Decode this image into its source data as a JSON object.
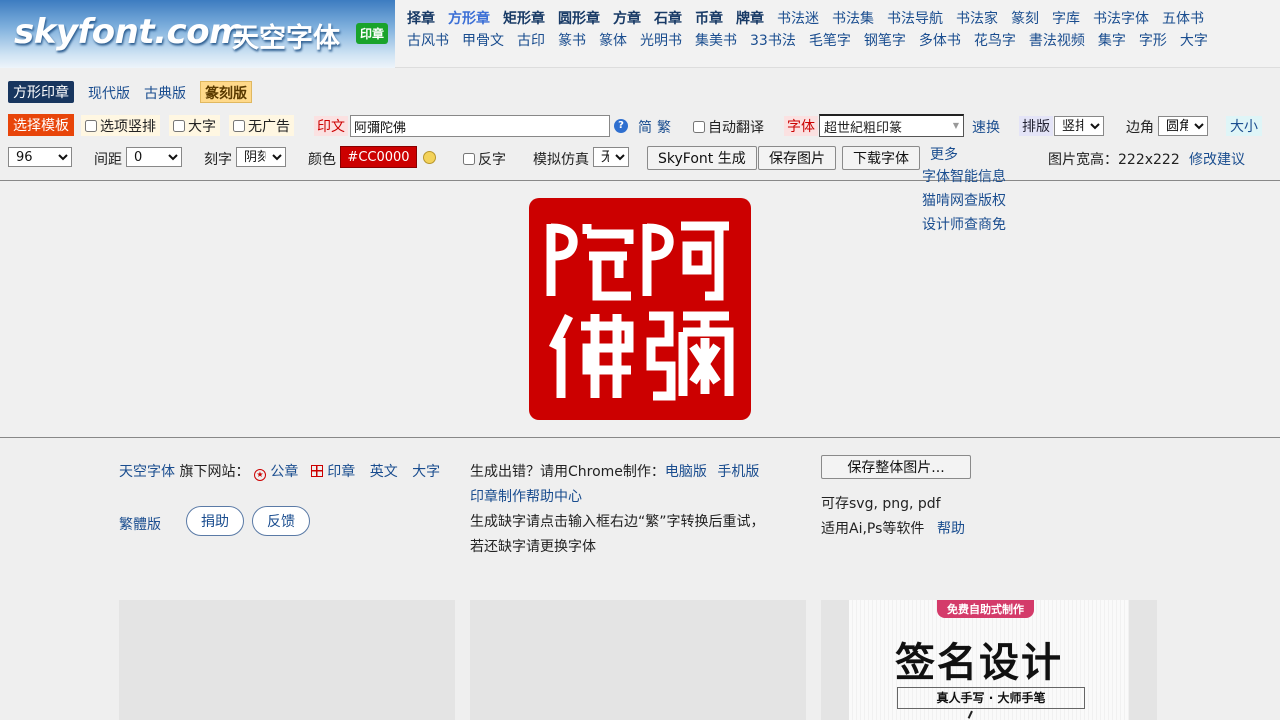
{
  "header": {
    "logo_text": "skyfont.com",
    "logo_cn": "天空字体",
    "logo_badge": "印章",
    "nav_row1": [
      {
        "label": "择章",
        "bold": true
      },
      {
        "label": "方形章",
        "bold": true,
        "active": true
      },
      {
        "label": "矩形章",
        "bold": true
      },
      {
        "label": "圆形章",
        "bold": true
      },
      {
        "label": "方章",
        "bold": true
      },
      {
        "label": "石章",
        "bold": true
      },
      {
        "label": "币章",
        "bold": true
      },
      {
        "label": "牌章",
        "bold": true
      },
      {
        "label": "书法迷"
      },
      {
        "label": "书法集"
      },
      {
        "label": "书法导航"
      },
      {
        "label": "书法家"
      },
      {
        "label": "篆刻"
      },
      {
        "label": "字库"
      },
      {
        "label": "书法字体"
      },
      {
        "label": "五体书"
      }
    ],
    "nav_row2": [
      "古风书",
      "甲骨文",
      "古印",
      "篆书",
      "篆体",
      "光明书",
      "集美书",
      "33书法",
      "毛笔字",
      "钢笔字",
      "多体书",
      "花鸟字",
      "書法视频",
      "集字",
      "字形",
      "大字"
    ]
  },
  "tabs": {
    "square": "方形印章",
    "modern": "现代版",
    "classic": "古典版",
    "seal_edition": "篆刻版"
  },
  "toolbar": {
    "choose_template": "选择模板",
    "option_vertical": "选项竖排",
    "big_text": "大字",
    "no_ads": "无广告",
    "seal_text_label": "印文",
    "seal_text_value": "阿彌陀佛",
    "simplified": "简",
    "traditional": "繁",
    "auto_translate": "自动翻译",
    "font_label": "字体",
    "font_value": "超世紀粗印篆",
    "quick_switch": "速换",
    "layout_label": "排版",
    "layout_value": "竖排",
    "corner_label": "边角",
    "corner_value": "圆角",
    "size_label": "大小",
    "size_value": "96",
    "spacing_label": "间距",
    "spacing_value": "0",
    "carve_label": "刻字",
    "carve_value": "阴刻",
    "color_label": "颜色",
    "color_value": "#CC0000",
    "reverse": "反字",
    "simulate_label": "模拟仿真",
    "simulate_value": "无",
    "generate_button": "SkyFont 生成",
    "save_image_button": "保存图片",
    "download_font_button": "下载字体",
    "more": "更多",
    "image_size": "图片宽高：222x222",
    "suggest": "修改建议",
    "font_info": "字体智能信息",
    "copyright_check": "猫啃网查版权",
    "designer_check": "设计师查商免"
  },
  "seal": {
    "color": "#cc0000",
    "chars": [
      "阿",
      "彌",
      "陀",
      "佛"
    ]
  },
  "footer": {
    "brand": "天空字体",
    "sub_sites_label": "旗下网站：",
    "site_gongzhang": "公章",
    "site_yinzhang": "印章",
    "site_english": "英文",
    "site_bigtext": "大字",
    "traditional_version": "繁體版",
    "donate": "捐助",
    "feedback": "反馈",
    "error_tip": "生成出错？请用Chrome制作：",
    "pc_version": "电脑版",
    "mobile_version": "手机版",
    "help_center": "印章制作帮助中心",
    "missing_tip1": "生成缺字请点击输入框右边“繁”字转换后重试，",
    "missing_tip2": "若还缺字请更换字体",
    "save_all_button": "保存整体图片...",
    "formats": "可存svg, png, pdf",
    "software": "适用Ai,Ps等软件",
    "help": "帮助"
  },
  "ad": {
    "badge": "免费自助式制作",
    "title": "签名设计",
    "subtitle": "真人手写 · 大师手笔"
  }
}
